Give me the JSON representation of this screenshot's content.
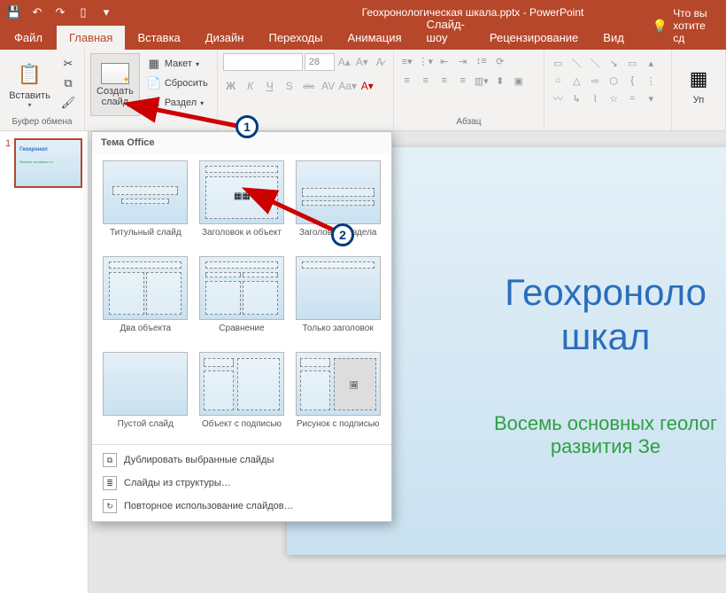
{
  "app": {
    "title": "Геохронологическая шкала.pptx - PowerPoint"
  },
  "qat": {
    "save": "💾",
    "undo": "↶",
    "redo": "↷",
    "start": "▯",
    "more": "▾"
  },
  "tabs": {
    "file": "Файл",
    "home": "Главная",
    "insert": "Вставка",
    "design": "Дизайн",
    "transitions": "Переходы",
    "animations": "Анимация",
    "slideshow": "Слайд-шоу",
    "review": "Рецензирование",
    "view": "Вид",
    "tellme_label": "Что вы хотите сд"
  },
  "ribbon": {
    "clipboard": {
      "label": "Буфер обмена",
      "paste": "Вставить",
      "cut": "",
      "copy": "",
      "format_painter": ""
    },
    "slides": {
      "new_slide": "Создать\nслайд",
      "layout": "Макет",
      "reset": "Сбросить",
      "section": "Раздел"
    },
    "font": {
      "size_value": "28",
      "bold": "Ж",
      "italic": "К",
      "underline": "Ч",
      "shadow": "S",
      "strike": "abc"
    },
    "paragraph": {
      "label": "Абзац"
    },
    "editing": {
      "label": "Уп"
    }
  },
  "gallery": {
    "header": "Тема Office",
    "layouts": [
      "Титульный слайд",
      "Заголовок и объект",
      "Заголовок раздела",
      "Два объекта",
      "Сравнение",
      "Только заголовок",
      "Пустой слайд",
      "Объект с подписью",
      "Рисунок с подписью"
    ],
    "menu": {
      "duplicate": "Дублировать выбранные слайды",
      "from_outline": "Слайды из структуры…",
      "reuse": "Повторное использование слайдов…"
    }
  },
  "thumbs": {
    "items": [
      {
        "num": "1",
        "title": "Геохронол",
        "subtitle": "Восемь основных ге"
      }
    ]
  },
  "slide": {
    "title_line1": "Геохроноло",
    "title_line2": "шкал",
    "subtitle_line1": "Восемь основных геолог",
    "subtitle_line2": "развития Зе"
  },
  "callouts": {
    "one": "1",
    "two": "2"
  }
}
